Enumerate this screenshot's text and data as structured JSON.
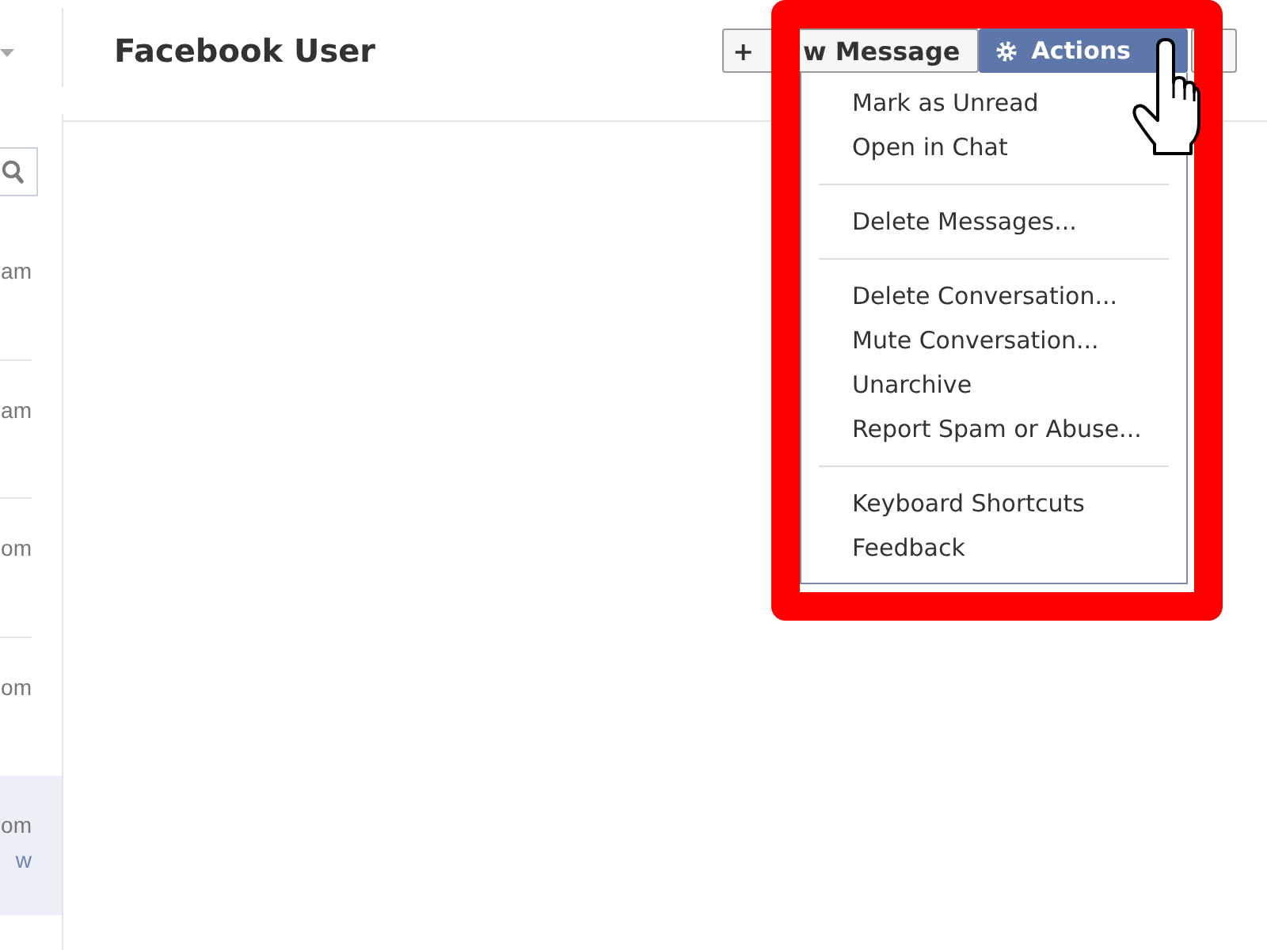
{
  "sidebar": {
    "threads": [
      {
        "line_1": "am",
        "selected": false
      },
      {
        "line_1": "am",
        "selected": false
      },
      {
        "line_1": "om",
        "selected": false
      },
      {
        "line_1": "om",
        "selected": false
      },
      {
        "line_1": "om",
        "line_2": "w",
        "selected": true
      }
    ]
  },
  "header": {
    "title": "Facebook User",
    "new_message_button": {
      "symbol": "+",
      "label": "w Message"
    },
    "actions_button": {
      "label": "Actions",
      "expanded": true
    }
  },
  "actions_menu": {
    "groups": [
      [
        "Mark as Unread",
        "Open in Chat"
      ],
      [
        "Delete Messages..."
      ],
      [
        "Delete Conversation...",
        "Mute Conversation...",
        "Unarchive",
        "Report Spam or Abuse..."
      ],
      [
        "Keyboard Shortcuts",
        "Feedback"
      ]
    ]
  }
}
